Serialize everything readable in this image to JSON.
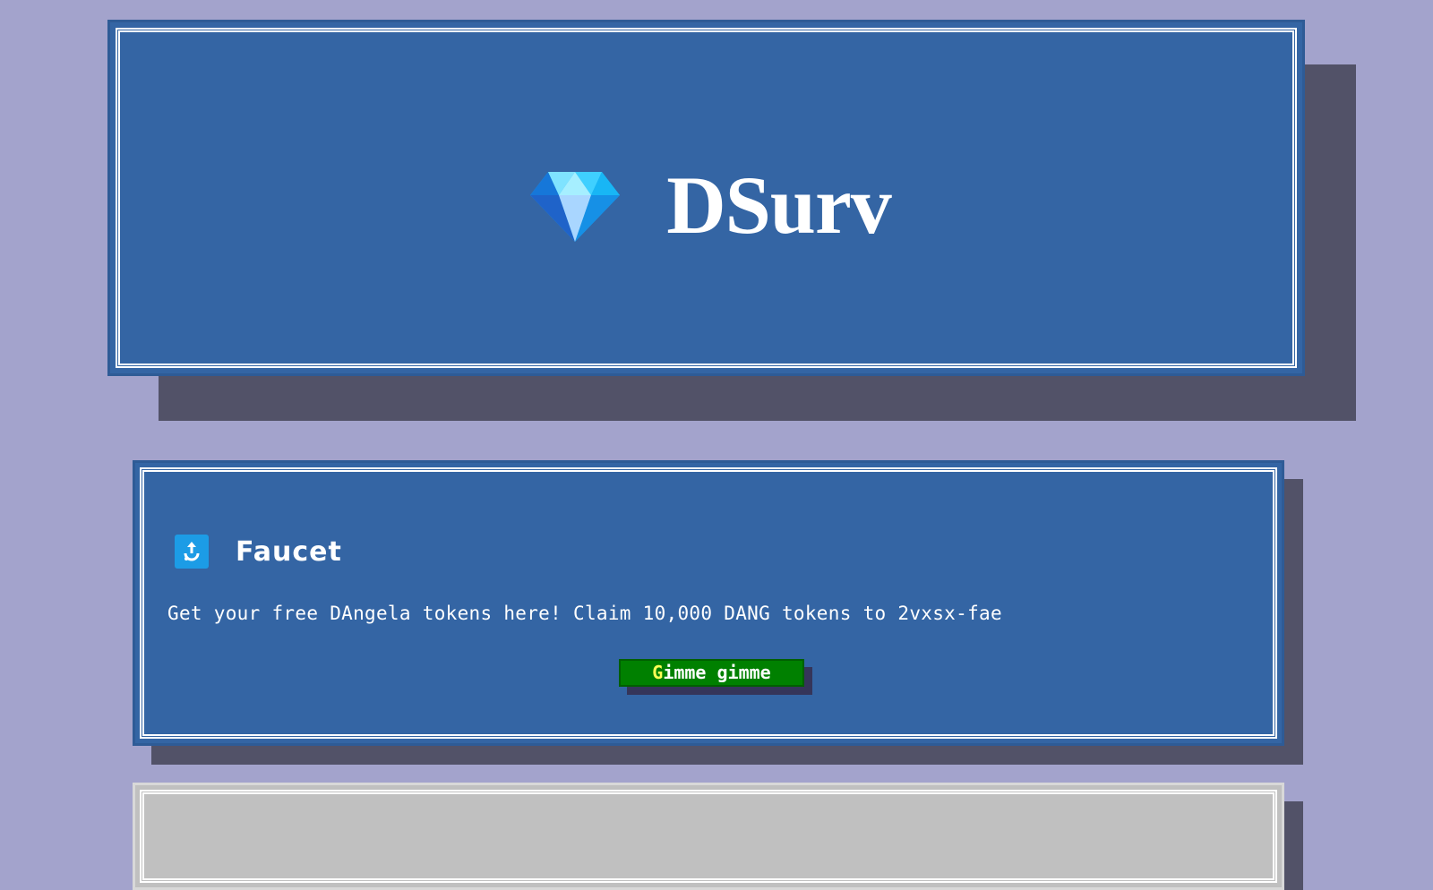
{
  "header": {
    "title": "DSurv",
    "logo_icon": "diamond-icon"
  },
  "faucet": {
    "icon": "faucet-icon",
    "title": "Faucet",
    "description": "Get your free DAngela tokens here! Claim 10,000 DANG tokens to 2vxsx-fae",
    "button_first_letter": "G",
    "button_rest": "imme gimme"
  },
  "colors": {
    "page_background": "#a3a3cc",
    "panel_blue": "#3465a4",
    "panel_shadow": "#525268",
    "button_green": "#008000",
    "button_accent": "#ffff55",
    "grey_panel": "#c0c0c0"
  }
}
